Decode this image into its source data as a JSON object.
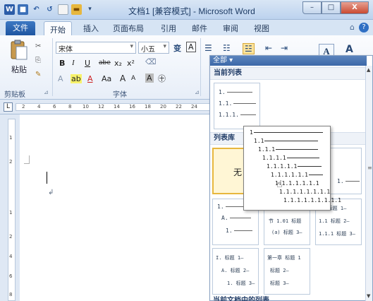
{
  "window": {
    "title": "文档1 [兼容模式] - Microsoft Word",
    "minimize": "–",
    "maximize": "□",
    "close": "X"
  },
  "quick_access": {
    "app_icon": "W",
    "icons": [
      "save-icon",
      "undo-icon",
      "redo-icon",
      "new-doc-icon",
      "open-icon",
      "customize-icon"
    ]
  },
  "tabs": [
    {
      "label": "文件"
    },
    {
      "label": "开始"
    },
    {
      "label": "插入"
    },
    {
      "label": "页面布局"
    },
    {
      "label": "引用"
    },
    {
      "label": "邮件"
    },
    {
      "label": "审阅"
    },
    {
      "label": "视图"
    }
  ],
  "ribbon": {
    "paste_label": "粘贴",
    "clipboard_group": "剪贴板",
    "font_group": "字体",
    "font_name": "宋体",
    "font_size": "小五",
    "bold": "B",
    "italic": "I",
    "underline": "U",
    "strike": "abe",
    "subscript": "x₂",
    "superscript": "x²",
    "grow_font": "A",
    "shrink_font": "A",
    "aa": "Aa",
    "char_shading": "A",
    "styles_letter": "A",
    "edit_letter": "A",
    "phonetic": "变",
    "border_char": "A"
  },
  "ruler": {
    "tab_stop": "L",
    "h_numbers": [
      "2",
      "4",
      "6",
      "8",
      "10",
      "12",
      "14",
      "16",
      "18",
      "20",
      "22",
      "24"
    ],
    "v_numbers": [
      "1",
      "2",
      "1",
      "2",
      "4",
      "6",
      "8"
    ]
  },
  "document": {
    "paragraph_mark": "↲"
  },
  "list_panel": {
    "header": "全部 ▾",
    "current_section": "当前列表",
    "library_section": "列表库",
    "bottom_section": "当前文档中的列表",
    "none_label": "无",
    "current_tile_lines": [
      "1.",
      "1.1.",
      "1.1.1."
    ],
    "tile_simple_lines": [
      "1.",
      "A.",
      "1."
    ],
    "tile_chapter": {
      "lines": [
        "节 1.01 标题",
        "(a) 标题 3—"
      ],
      "top": "—"
    },
    "tile_heading": {
      "lines": [
        "1. 标题 1—",
        "1.1 标题 2—",
        "1.1.1 标题 3—"
      ]
    },
    "tile_heading_b": {
      "lines": [
        "I. 标题 1—",
        "A. 标题 2—",
        "1. 标题 3—"
      ]
    },
    "tile_heading_c": {
      "lines": [
        "第一章 标题 1",
        "标题 2—",
        "标题 3—"
      ]
    },
    "partial_tile_line": "1.",
    "preview_lines": [
      "1",
      "1.1",
      "1.1.1",
      "1.1.1.1",
      "1.1.1.1.1",
      "1.1.1.1.1.1",
      "1.1.1.1.1.1.1",
      "1.1.1.1.1.1.1.1",
      "1.1.1.1.1.1.1.1.1"
    ]
  }
}
